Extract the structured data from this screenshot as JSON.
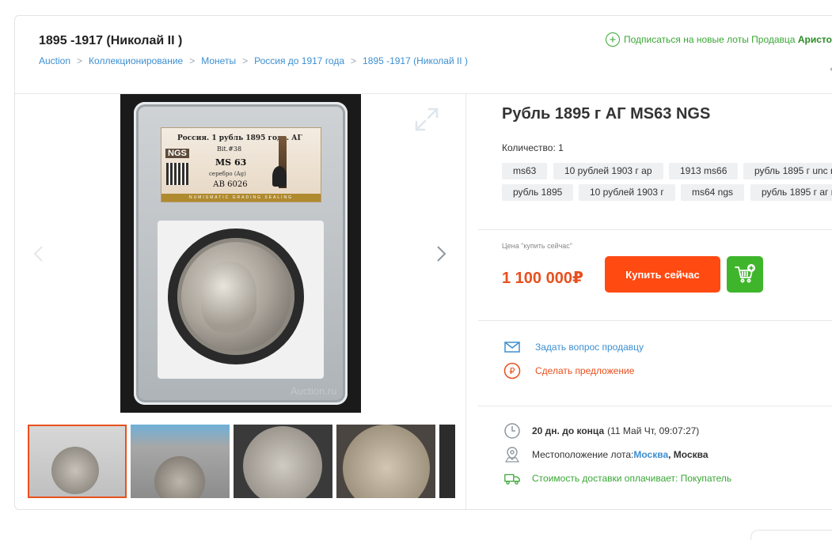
{
  "header": {
    "title": "1895 -1917 (Николай II )",
    "breadcrumb": [
      "Auction",
      "Коллекционирование",
      "Монеты",
      "Россия до 1917 года",
      "1895 -1917 (Николай II )"
    ],
    "breadcrumb_sep": ">",
    "subscribe_text": "Подписаться на новые лоты Продавца",
    "seller_name": "Аристо"
  },
  "gallery": {
    "label": {
      "line1": "Россия. 1 рубль 1895 года. АГ",
      "line2": "Bit.#38",
      "brand": "NGS",
      "grade": "MS 63",
      "metal": "серебро (Ag)",
      "cert": "АВ 6026",
      "strip": "NUMISMATIC GRADING SEALING"
    },
    "watermark": "Auction.ru",
    "thumbnail_count": 5,
    "active_thumbnail": 1
  },
  "lot": {
    "title": "Рубль 1895 г АГ MS63 NGS",
    "quantity_label": "Количество: 1",
    "tags": [
      "ms63",
      "10 рублей 1903 г ар",
      "1913 ms66",
      "рубль 1895 г unc n",
      "рубль 1895",
      "10 рублей 1903 г",
      "ms64 ngs",
      "рубль 1895 г аг n"
    ],
    "price_label": "Цена \"купить сейчас\"",
    "price": "1 100 000₽",
    "buy_label": "Купить сейчас",
    "ask_seller": "Задать вопрос продавцу",
    "make_offer": "Сделать предложение",
    "time_left": "20 дн. до конца",
    "end_date": "(11 Май Чт, 09:07:27)",
    "location_label": "Местоположение лота:",
    "location_city_link": "Москва",
    "location_city": ", Москва",
    "shipping": "Стоимость доставки оплачивает: Покупатель"
  },
  "colors": {
    "accent_orange": "#ff4a12",
    "price_red": "#e8501d",
    "link_blue": "#3d8fd1",
    "green": "#3aa635"
  }
}
